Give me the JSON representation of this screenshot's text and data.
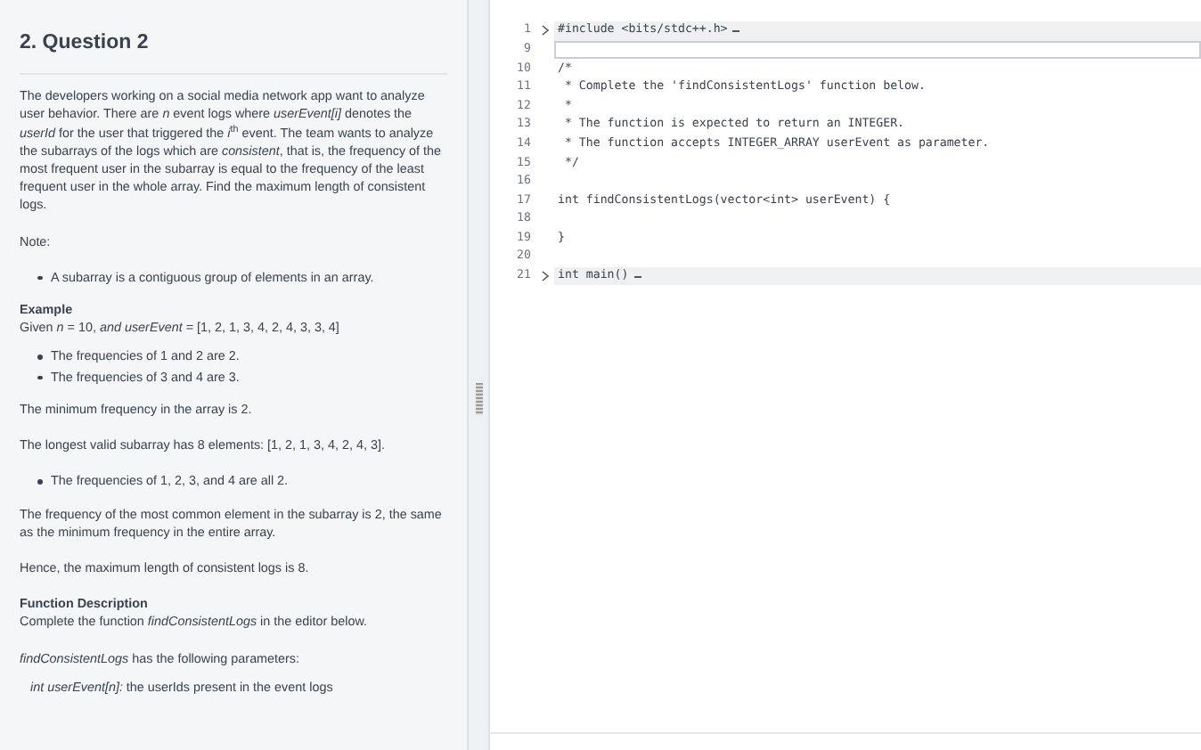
{
  "question": {
    "title": "2. Question 2",
    "blocks": [
      {
        "kind": "paragraph",
        "text": "The developers working on a social media network app want to analyze user behavior. There are *n* event logs where *userEvent[i]* denotes the *userId* for the user that triggered the *i*$^{th}$ event. The team wants to analyze the subarrays of the logs which are *consistent*, that is, the frequency of the most frequent user in the subarray is equal to the frequency of the least frequent user in the whole array. Find the maximum length of consistent logs."
      },
      {
        "kind": "paragraph",
        "text": "Note:"
      },
      {
        "kind": "bullets",
        "items": [
          "A subarray is a contiguous group of elements in an array."
        ]
      },
      {
        "kind": "heading",
        "text": "Example"
      },
      {
        "kind": "line",
        "text": "Given *n* = 10, *and userEvent* = [1, 2, 1, 3, 4, 2, 4, 3, 3, 4]"
      },
      {
        "kind": "bullets",
        "items": [
          "The frequencies of 1 and 2 are 2.",
          "The frequencies of 3 and 4 are 3."
        ]
      },
      {
        "kind": "paragraph",
        "text": "The minimum frequency in the array is 2."
      },
      {
        "kind": "paragraph",
        "text": "The longest valid subarray has 8 elements: [1, 2, 1, 3, 4, 2, 4, 3]."
      },
      {
        "kind": "bullets",
        "items": [
          "The frequencies of 1, 2, 3, and 4 are all 2."
        ]
      },
      {
        "kind": "paragraph",
        "text": "The frequency of the most common element in the subarray is 2, the same as the minimum frequency in the entire array."
      },
      {
        "kind": "paragraph",
        "text": "Hence, the maximum length of consistent logs is 8."
      },
      {
        "kind": "heading",
        "text": "Function Description"
      },
      {
        "kind": "paragraph",
        "text": "Complete the function *findConsistentLogs* in the editor below."
      },
      {
        "kind": "line",
        "text": "*findConsistentLogs* has the following parameters:"
      },
      {
        "kind": "param",
        "text": "*int userEvent[n]:*  the userIds present in the event logs"
      }
    ]
  },
  "editor": {
    "lines": [
      {
        "number": "1",
        "text": "#include <bits/stdc++.h>",
        "folded": true,
        "active": false
      },
      {
        "number": "9",
        "folded": false,
        "active": true
      },
      {
        "number": "10",
        "text": "/*",
        "folded": false,
        "active": false
      },
      {
        "number": "11",
        "text": " * Complete the 'findConsistentLogs' function below.",
        "folded": false,
        "active": false
      },
      {
        "number": "12",
        "text": " *",
        "folded": false,
        "active": false
      },
      {
        "number": "13",
        "text": " * The function is expected to return an INTEGER.",
        "folded": false,
        "active": false
      },
      {
        "number": "14",
        "text": " * The function accepts INTEGER_ARRAY userEvent as parameter.",
        "folded": false,
        "active": false
      },
      {
        "number": "15",
        "text": " */",
        "folded": false,
        "active": false
      },
      {
        "number": "16",
        "folded": false,
        "active": false
      },
      {
        "number": "17",
        "text": "int findConsistentLogs(vector<int> userEvent) {",
        "folded": false,
        "active": false
      },
      {
        "number": "18",
        "folded": false,
        "active": false
      },
      {
        "number": "19",
        "text": "}",
        "folded": false,
        "active": false
      },
      {
        "number": "20",
        "folded": false,
        "active": false
      },
      {
        "number": "21",
        "text": "int main()",
        "folded": true,
        "active": false
      }
    ]
  }
}
